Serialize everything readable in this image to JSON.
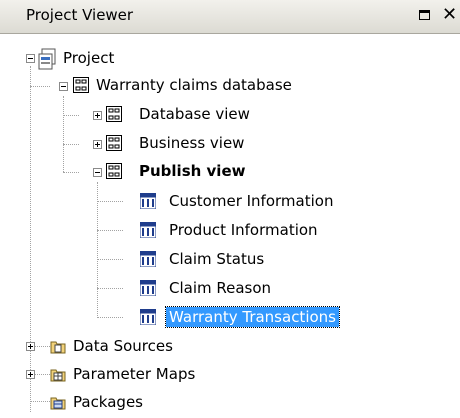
{
  "window": {
    "title": "Project Viewer",
    "maximize_glyph": "☐",
    "close_glyph": "✕"
  },
  "tree": {
    "project": "Project",
    "database": "Warranty claims database",
    "database_view": "Database view",
    "business_view": "Business view",
    "publish_view": "Publish view",
    "subjects": [
      "Customer Information",
      "Product Information",
      "Claim Status",
      "Claim Reason",
      "Warranty Transactions"
    ],
    "data_sources": "Data Sources",
    "parameter_maps": "Parameter Maps",
    "packages": "Packages",
    "selected": "Warranty Transactions"
  },
  "icons": {
    "project": "project-icon",
    "namespace": "namespace-icon",
    "query_subject": "query-subject-icon",
    "data_sources": "data-sources-folder-icon",
    "parameter_maps": "parameter-maps-folder-icon",
    "packages": "packages-icon"
  }
}
